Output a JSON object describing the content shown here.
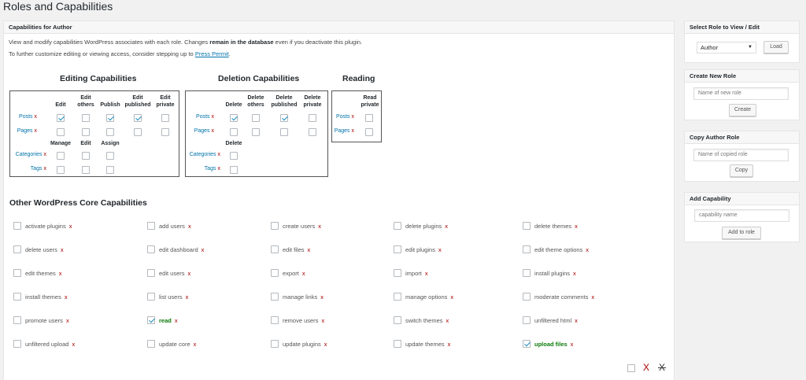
{
  "page_title": "Roles and Capabilities",
  "main": {
    "header": "Capabilities for Author",
    "intro1_a": "View and modify capabilities WordPress associates with each role. Changes",
    "intro1_b": "remain in the database",
    "intro1_c": "even if you deactivate this plugin.",
    "intro2_a": "To further customize editing or viewing access, consider stepping up to",
    "intro2_link": "Press Permit",
    "intro2_c": "."
  },
  "editing": {
    "title": "Editing Capabilities",
    "cols": [
      "Edit",
      "Edit\nothers",
      "Publish",
      "Edit\npublished",
      "Edit\nprivate"
    ],
    "rows": [
      {
        "label": "Posts",
        "x": "x",
        "checks": [
          true,
          false,
          true,
          true,
          false
        ]
      },
      {
        "label": "Pages",
        "x": "x",
        "checks": [
          false,
          false,
          false,
          false,
          false
        ]
      }
    ],
    "tax_cols": [
      "Manage",
      "Edit",
      "Assign"
    ],
    "tax_rows": [
      {
        "label": "Categories",
        "x": "x"
      },
      {
        "label": "Tags",
        "x": "x"
      }
    ]
  },
  "deletion": {
    "title": "Deletion Capabilities",
    "cols": [
      "Delete",
      "Delete\nothers",
      "Delete\npublished",
      "Delete\nprivate"
    ],
    "rows": [
      {
        "label": "Posts",
        "x": "x",
        "checks": [
          true,
          false,
          true,
          false
        ]
      },
      {
        "label": "Pages",
        "x": "x",
        "checks": [
          false,
          false,
          false,
          false
        ]
      }
    ],
    "tax_col": "Delete",
    "tax_rows": [
      {
        "label": "Categories",
        "x": "x"
      },
      {
        "label": "Tags",
        "x": "x"
      }
    ]
  },
  "reading": {
    "title": "Reading",
    "col": "Read\nprivate",
    "rows": [
      {
        "label": "Posts",
        "x": "x"
      },
      {
        "label": "Pages",
        "x": "x"
      }
    ]
  },
  "other": {
    "title": "Other WordPress Core Capabilities",
    "x": "x",
    "caps": [
      [
        "activate plugins",
        "add users",
        "create users",
        "delete plugins",
        "delete themes"
      ],
      [
        "delete users",
        "edit dashboard",
        "edit files",
        "edit plugins",
        "edit theme options"
      ],
      [
        "edit themes",
        "edit users",
        "export",
        "import",
        "install plugins"
      ],
      [
        "install themes",
        "list users",
        "manage links",
        "manage options",
        "moderate comments"
      ],
      [
        "promote users",
        "read",
        "remove users",
        "switch themes",
        "unfiltered html"
      ],
      [
        "unfiltered upload",
        "update core",
        "update plugins",
        "update themes",
        "upload files"
      ]
    ],
    "checked": [
      "read",
      "upload files"
    ]
  },
  "bottom": {
    "x1": "X",
    "x2": "X"
  },
  "sidebar": {
    "select_role": {
      "title": "Select Role to View / Edit",
      "value": "Author",
      "button": "Load"
    },
    "create_role": {
      "title": "Create New Role",
      "placeholder": "Name of new role",
      "button": "Create"
    },
    "copy_role": {
      "title": "Copy Author Role",
      "placeholder": "Name of copied role",
      "button": "Copy"
    },
    "add_cap": {
      "title": "Add Capability",
      "placeholder": "capability name",
      "button": "Add to role"
    }
  }
}
